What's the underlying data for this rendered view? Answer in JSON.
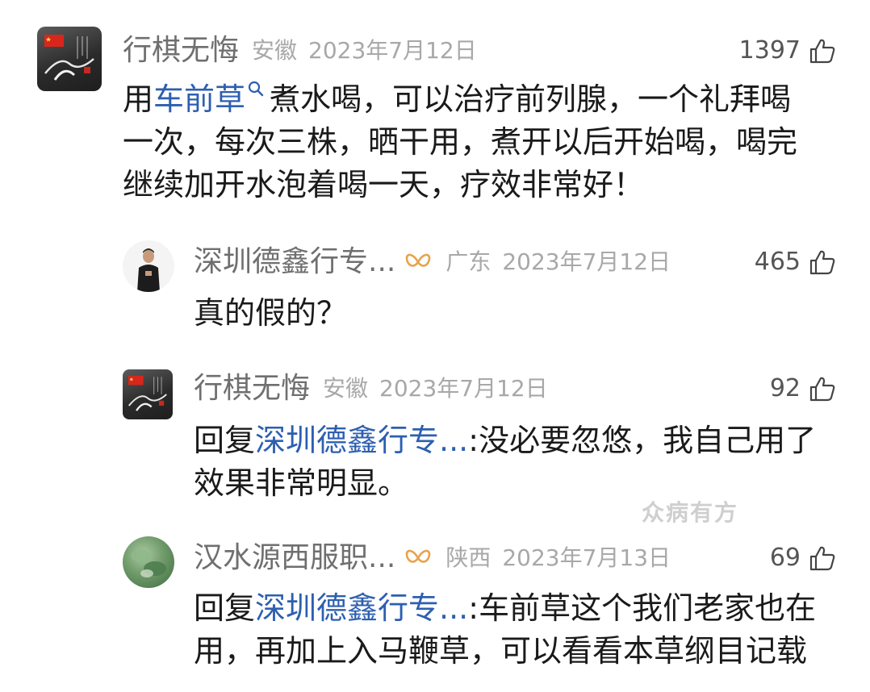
{
  "comments": [
    {
      "username": "行棋无悔",
      "region": "安徽",
      "date": "2023年7月12日",
      "likes": "1397",
      "text": {
        "prefix": "用",
        "link": "车前草",
        "line1_rest": "煮水喝，可以治疗前列腺，一个礼拜喝",
        "line2": "一次，每次三株，晒干用，煮开以后开始喝，喝完",
        "line3": "继续加开水泡着喝一天，疗效非常好！"
      }
    }
  ],
  "replies": [
    {
      "username": "深圳德鑫行专...",
      "region": "广东",
      "date": "2023年7月12日",
      "likes": "465",
      "text": "真的假的？",
      "has_vip_badge": true
    },
    {
      "username": "行棋无悔",
      "region": "安徽",
      "date": "2023年7月12日",
      "likes": "92",
      "reply_prefix": "回复",
      "reply_target": "深圳德鑫行专...",
      "line1_rest": ":没必要忽悠，我自己用了",
      "line2": "效果非常明显。",
      "has_vip_badge": false
    },
    {
      "username": "汉水源西服职...",
      "region": "陕西",
      "date": "2023年7月13日",
      "likes": "69",
      "reply_prefix": "回复",
      "reply_target": "深圳德鑫行专...",
      "line1_rest": ":车前草这个我们老家也在",
      "line2": "用，再加上入马鞭草，可以看看本草纲目记载",
      "has_vip_badge": true
    }
  ],
  "watermark": "众病有方",
  "icons": {
    "like": "thumbs-up-icon",
    "vip": "vip-badge-icon",
    "search": "search-icon"
  },
  "colors": {
    "link": "#2d5fb0",
    "username": "#6f6f6f",
    "meta": "#a8a8a8",
    "vip_badge": "#e8a24a"
  }
}
